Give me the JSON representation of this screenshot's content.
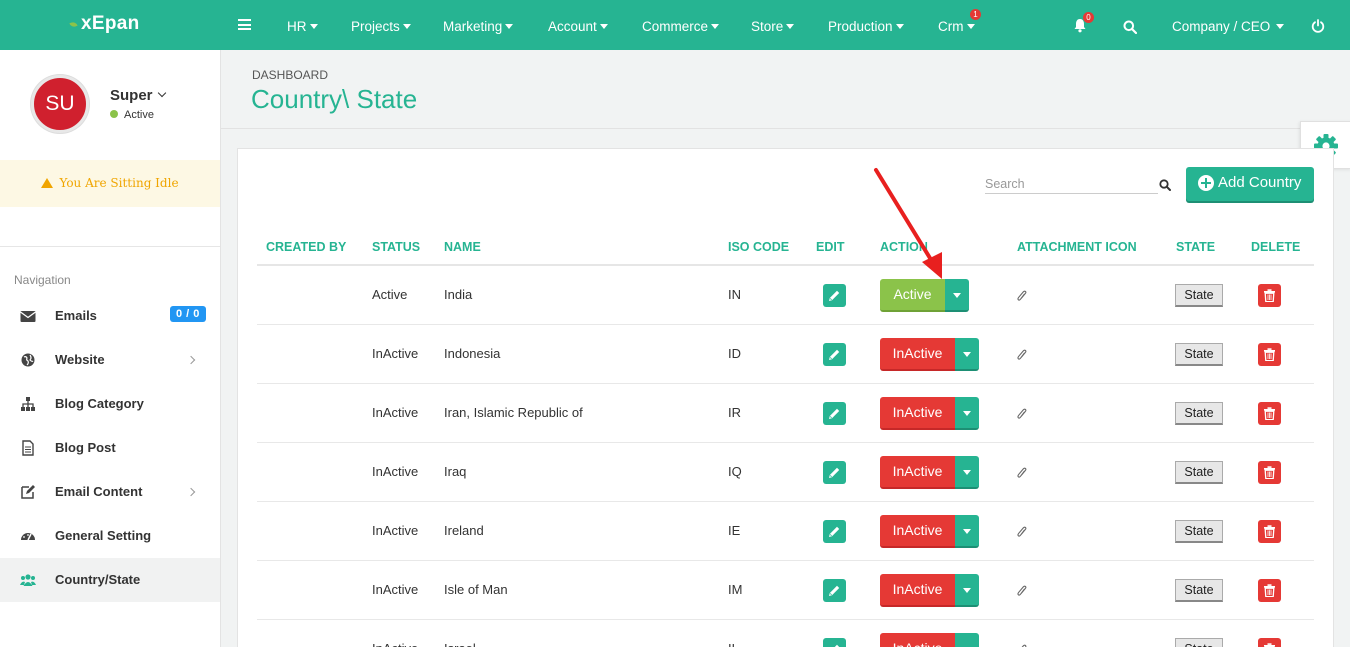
{
  "topbar": {
    "logo": "xEpan",
    "menu": [
      {
        "label": "HR"
      },
      {
        "label": "Projects"
      },
      {
        "label": "Marketing"
      },
      {
        "label": "Account"
      },
      {
        "label": "Commerce"
      },
      {
        "label": "Store"
      },
      {
        "label": "Production"
      },
      {
        "label": "Crm",
        "badge": "1"
      }
    ],
    "notification_count": "0",
    "user_menu": "Company / CEO"
  },
  "sidebar": {
    "avatar_initials": "SU",
    "user_name": "Super",
    "user_status": "Active",
    "idle_message": "You Are Sitting Idle",
    "nav_header": "Navigation",
    "items": [
      {
        "label": "Emails",
        "icon": "envelope-icon",
        "badge": "0 / 0"
      },
      {
        "label": "Website",
        "icon": "globe-icon",
        "has_submenu": true
      },
      {
        "label": "Blog Category",
        "icon": "sitemap-icon"
      },
      {
        "label": "Blog Post",
        "icon": "file-icon"
      },
      {
        "label": "Email Content",
        "icon": "edit-icon",
        "has_submenu": true
      },
      {
        "label": "General Setting",
        "icon": "dashboard-icon"
      },
      {
        "label": "Country/State",
        "icon": "users-icon",
        "active": true
      }
    ]
  },
  "page": {
    "breadcrumb": "DASHBOARD",
    "title": "Country\\ State"
  },
  "toolbar": {
    "search_placeholder": "Search",
    "add_label": "Add Country"
  },
  "table": {
    "columns": [
      "CREATED BY",
      "STATUS",
      "NAME",
      "ISO CODE",
      "EDIT",
      "ACTION",
      "ATTACHMENT ICON",
      "STATE",
      "DELETE"
    ],
    "rows": [
      {
        "created_by": "",
        "status": "Active",
        "name": "India",
        "iso": "IN",
        "action": "Active",
        "state": "State"
      },
      {
        "created_by": "",
        "status": "InActive",
        "name": "Indonesia",
        "iso": "ID",
        "action": "InActive",
        "state": "State"
      },
      {
        "created_by": "",
        "status": "InActive",
        "name": "Iran, Islamic Republic of",
        "iso": "IR",
        "action": "InActive",
        "state": "State"
      },
      {
        "created_by": "",
        "status": "InActive",
        "name": "Iraq",
        "iso": "IQ",
        "action": "InActive",
        "state": "State"
      },
      {
        "created_by": "",
        "status": "InActive",
        "name": "Ireland",
        "iso": "IE",
        "action": "InActive",
        "state": "State"
      },
      {
        "created_by": "",
        "status": "InActive",
        "name": "Isle of Man",
        "iso": "IM",
        "action": "InActive",
        "state": "State"
      },
      {
        "created_by": "",
        "status": "InActive",
        "name": "Israel",
        "iso": "IL",
        "action": "InActive",
        "state": "State"
      }
    ]
  },
  "colors": {
    "brand": "#26b492",
    "danger": "#e53935",
    "success": "#8bc34a",
    "annotation_arrow": "#e8201f"
  }
}
